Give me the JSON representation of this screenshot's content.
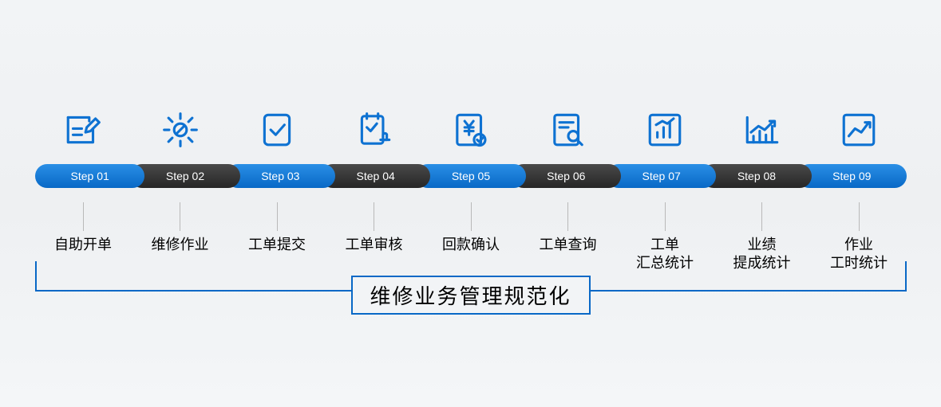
{
  "steps": [
    {
      "pill": "Step 01",
      "label": "自助开单",
      "icon": "edit-form-icon"
    },
    {
      "pill": "Step 02",
      "label": "维修作业",
      "icon": "gear-wrench-icon"
    },
    {
      "pill": "Step 03",
      "label": "工单提交",
      "icon": "document-check-icon"
    },
    {
      "pill": "Step 04",
      "label": "工单审核",
      "icon": "clipboard-stamp-icon"
    },
    {
      "pill": "Step 05",
      "label": "回款确认",
      "icon": "payment-confirm-icon"
    },
    {
      "pill": "Step 06",
      "label": "工单查询",
      "icon": "document-search-icon"
    },
    {
      "pill": "Step 07",
      "label": "工单\n汇总统计",
      "icon": "bar-chart-icon"
    },
    {
      "pill": "Step 08",
      "label": "业绩\n提成统计",
      "icon": "trend-chart-icon"
    },
    {
      "pill": "Step 09",
      "label": "作业\n工时统计",
      "icon": "line-chart-icon"
    }
  ],
  "title": "维修业务管理规范化",
  "colors": {
    "blue": "#0e72d2",
    "dark": "#2e2e2e"
  }
}
